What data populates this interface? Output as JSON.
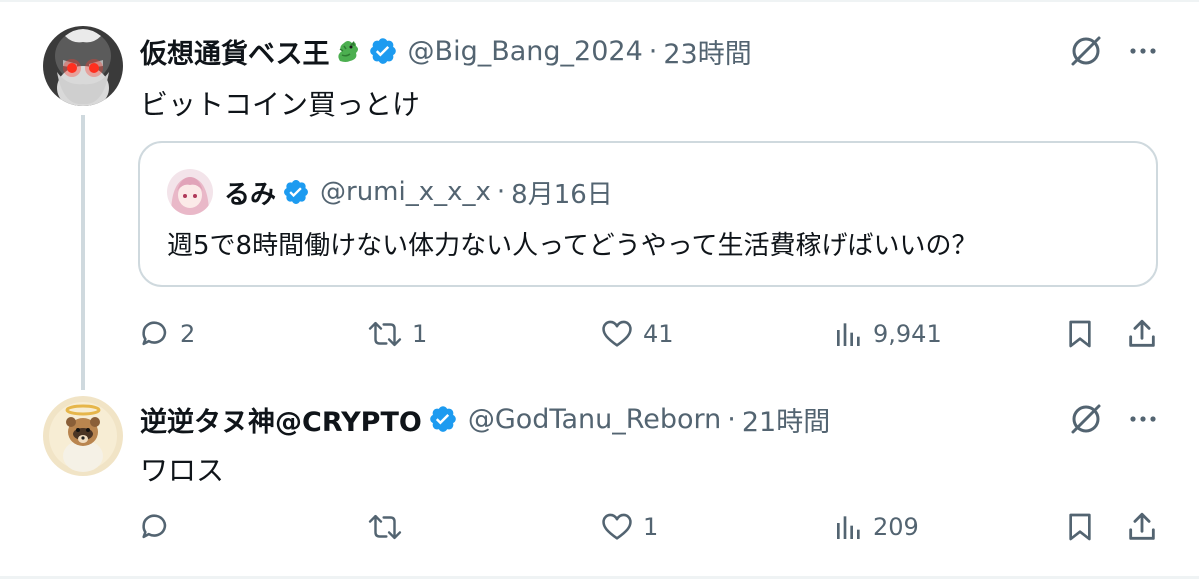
{
  "posts": [
    {
      "display_name": "仮想通貨ベス王",
      "name_emoji": "dragon-emoji",
      "handle": "@Big_Bang_2024",
      "separator": "·",
      "time": "23時間",
      "text": "ビットコイン買っとけ",
      "quote": {
        "display_name": "るみ",
        "handle": "@rumi_x_x_x",
        "separator": "·",
        "date": "8月16日",
        "text": "週5で8時間働けない体力ない人ってどうやって生活費稼げばいいの？"
      },
      "actions": {
        "replies": "2",
        "reposts": "1",
        "likes": "41",
        "views": "9,941"
      }
    },
    {
      "display_name": "逆逆タヌ神@CRYPTO",
      "handle": "@GodTanu_Reborn",
      "separator": "·",
      "time": "21時間",
      "text": "ワロス",
      "actions": {
        "replies": "",
        "reposts": "",
        "likes": "1",
        "views": "209"
      }
    }
  ],
  "colors": {
    "verified": "#1d9bf0",
    "secondary_text": "#536471",
    "border": "#cfd9de"
  },
  "icons": [
    "grok-icon",
    "more-icon",
    "reply-icon",
    "repost-icon",
    "like-icon",
    "views-icon",
    "bookmark-icon",
    "share-icon",
    "verified-badge-icon"
  ]
}
